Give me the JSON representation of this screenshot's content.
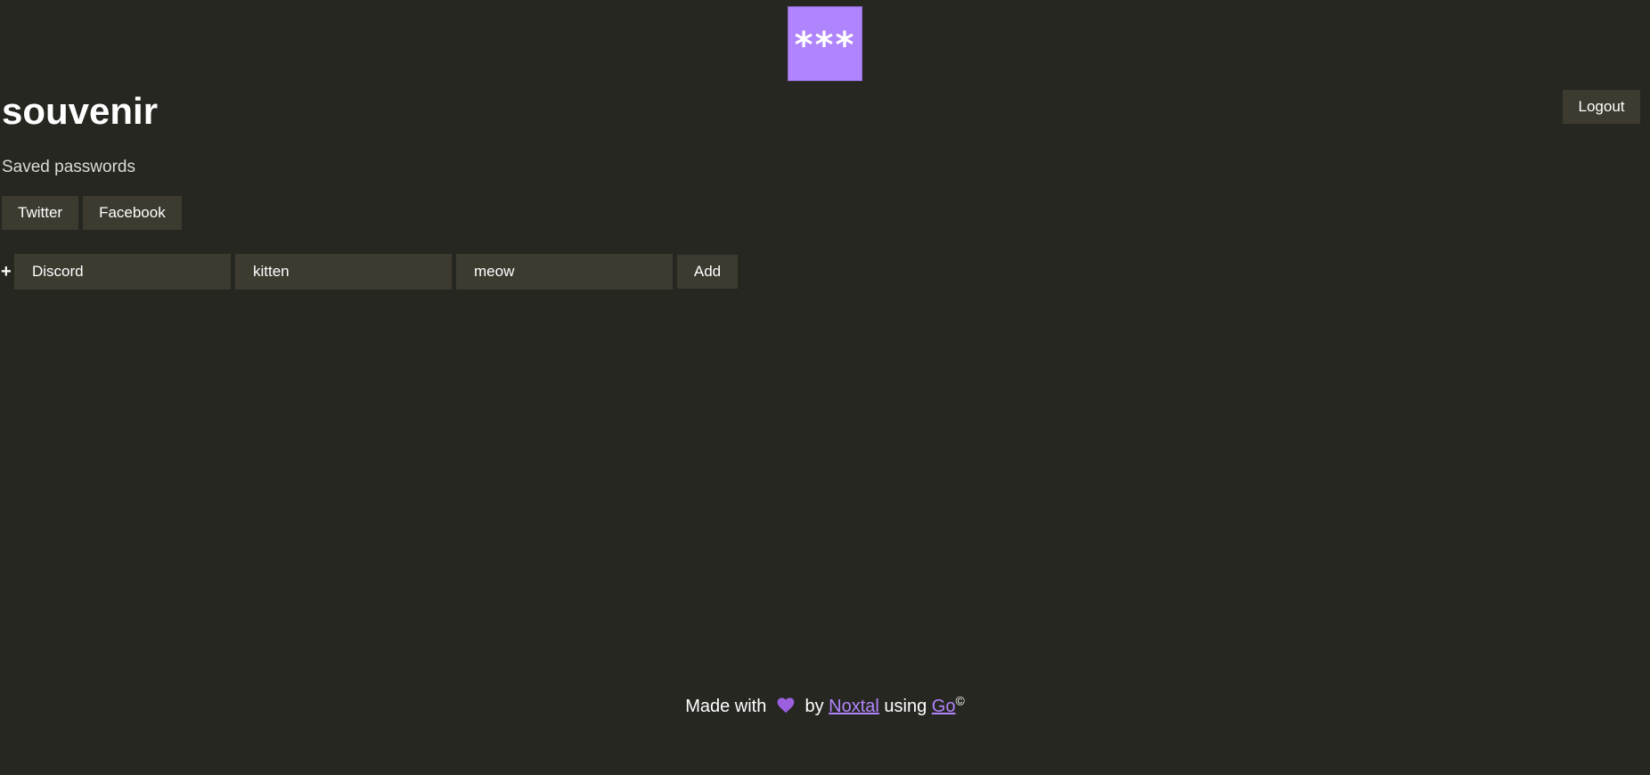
{
  "logo": {
    "text": "***"
  },
  "header": {
    "title": "souvenir",
    "logout_label": "Logout"
  },
  "saved": {
    "heading": "Saved passwords",
    "items": [
      {
        "label": "Twitter"
      },
      {
        "label": "Facebook"
      }
    ]
  },
  "add_form": {
    "plus": "+",
    "service_value": "Discord",
    "username_value": "kitten",
    "password_value": "meow",
    "add_label": "Add"
  },
  "footer": {
    "made_with": "Made with",
    "by": "by",
    "author": "Noxtal",
    "using": "using",
    "language": "Go",
    "copyright": "©",
    "heart_icon": "heart-icon",
    "heart_color": "#9b5fe0"
  },
  "colors": {
    "background": "#272722",
    "button": "#3d3b30",
    "accent": "#b084fc"
  }
}
